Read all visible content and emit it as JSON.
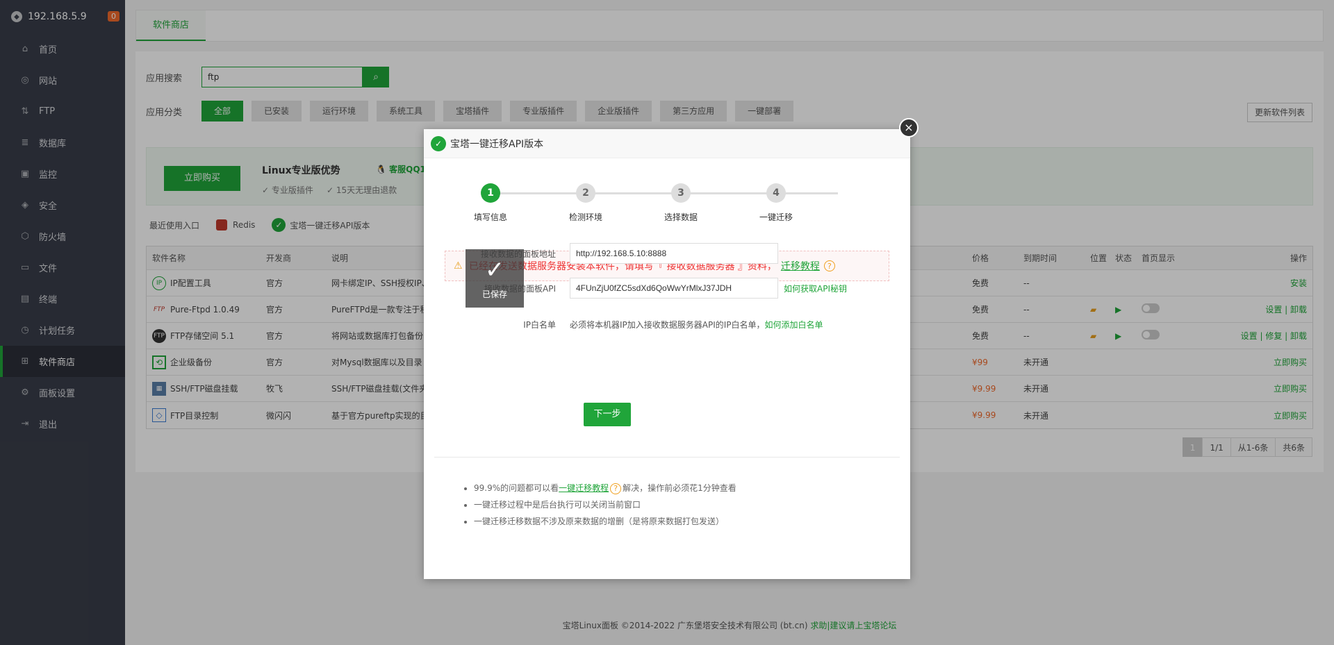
{
  "sidebar": {
    "host": "192.168.5.9",
    "badge": "0",
    "items": [
      {
        "label": "首页",
        "icon": "home-icon",
        "glyph": "⌂"
      },
      {
        "label": "网站",
        "icon": "globe-icon",
        "glyph": "◎"
      },
      {
        "label": "FTP",
        "icon": "ftp-icon",
        "glyph": "⇅"
      },
      {
        "label": "数据库",
        "icon": "database-icon",
        "glyph": "≣"
      },
      {
        "label": "监控",
        "icon": "monitor-icon",
        "glyph": "▣"
      },
      {
        "label": "安全",
        "icon": "shield-icon",
        "glyph": "◈"
      },
      {
        "label": "防火墙",
        "icon": "firewall-icon",
        "glyph": "⬡"
      },
      {
        "label": "文件",
        "icon": "folder-icon",
        "glyph": "▭"
      },
      {
        "label": "终端",
        "icon": "terminal-icon",
        "glyph": "▤"
      },
      {
        "label": "计划任务",
        "icon": "clock-icon",
        "glyph": "◷"
      },
      {
        "label": "软件商店",
        "icon": "apps-icon",
        "glyph": "⊞"
      },
      {
        "label": "面板设置",
        "icon": "gear-icon",
        "glyph": "⚙"
      },
      {
        "label": "退出",
        "icon": "logout-icon",
        "glyph": "⇥"
      }
    ]
  },
  "tabbar": {
    "active_tab": "软件商店"
  },
  "search": {
    "label": "应用搜索",
    "value": "ftp"
  },
  "category": {
    "label": "应用分类",
    "items": [
      "全部",
      "已安装",
      "运行环境",
      "系统工具",
      "宝塔插件",
      "专业版插件",
      "企业版插件",
      "第三方应用",
      "一键部署"
    ],
    "refresh_label": "更新软件列表"
  },
  "promo": {
    "buy_label": "立即购买",
    "title": "Linux专业版优势",
    "qq_label": "客服QQ1",
    "feature_1": "专业版插件",
    "feature_2": "15天无理由退款"
  },
  "recent": {
    "label": "最近使用入口",
    "items": [
      "Redis",
      "宝塔一键迁移API版本"
    ]
  },
  "table": {
    "headers": {
      "name": "软件名称",
      "dev": "开发商",
      "desc": "说明",
      "price": "价格",
      "expire": "到期时间",
      "position": "位置",
      "status": "状态",
      "home": "首页显示",
      "ops": "操作"
    },
    "rows": [
      {
        "name": "IP配置工具",
        "dev": "官方",
        "desc": "网卡绑定IP、SSH授权IP、",
        "price": "免费",
        "expire": "--",
        "ops": "安装"
      },
      {
        "name": "Pure-Ftpd 1.0.49",
        "dev": "官方",
        "desc": "PureFTPd是一款专注于程",
        "price": "免费",
        "expire": "--",
        "ops": "设置 | 卸载"
      },
      {
        "name": "FTP存储空间 5.1",
        "dev": "官方",
        "desc": "将网站或数据库打包备份",
        "price": "免费",
        "expire": "--",
        "ops": "设置 | 修复 | 卸载"
      },
      {
        "name": "企业级备份",
        "dev": "官方",
        "desc": "对Mysql数据库以及目录",
        "price": "¥99",
        "expire": "未开通",
        "ops": "立即购买"
      },
      {
        "name": "SSH/FTP磁盘挂载",
        "dev": "牧飞",
        "desc": "SSH/FTP磁盘挂载(文件夹",
        "price": "¥9.99",
        "expire": "未开通",
        "ops": "立即购买"
      },
      {
        "name": "FTP目录控制",
        "dev": "微闪闪",
        "desc": "基于官方pureftp实现的目",
        "price": "¥9.99",
        "expire": "未开通",
        "ops": "立即购买"
      }
    ]
  },
  "pager": {
    "current": "1",
    "pages": "1/1",
    "range": "从1-6条",
    "total": "共6条"
  },
  "footer": {
    "copyright": "宝塔Linux面板 ©2014-2022 广东堡塔安全技术有限公司 (bt.cn)",
    "link": "求助|建议请上宝塔论坛"
  },
  "modal": {
    "title": "宝塔一键迁移API版本",
    "close": "×",
    "steps": [
      {
        "num": "1",
        "label": "填写信息"
      },
      {
        "num": "2",
        "label": "检测环境"
      },
      {
        "num": "3",
        "label": "选择数据"
      },
      {
        "num": "4",
        "label": "一键迁移"
      }
    ],
    "warning": {
      "text": "已经在发送数据服务器安装本软件，请填写『 接收数据服务器 』资料，",
      "link": "迁移教程",
      "help": "?"
    },
    "toast": {
      "text": "已保存"
    },
    "fields": {
      "url_label": "接收数据的面板地址",
      "url_value": "http://192.168.5.10:8888",
      "api_label": "接收数据的面板API",
      "api_value": "4FUnZjU0fZC5sdXd6QoWwYrMlxJ37JDH",
      "api_link": "如何获取API秘钥",
      "ip_label": "IP白名单",
      "ip_text": "必须将本机器IP加入接收数据服务器API的IP白名单，",
      "ip_link": "如何添加白名单"
    },
    "next_label": "下一步",
    "tips": {
      "t1_a": "99.9%的问题都可以看",
      "t1_link": "一键迁移教程",
      "t1_b": "解决，操作前必须花1分钟查看",
      "t2": "一键迁移过程中是后台执行可以关闭当前窗口",
      "t3": "一键迁移迁移数据不涉及原来数据的增删（是将原来数据打包发送）"
    }
  }
}
